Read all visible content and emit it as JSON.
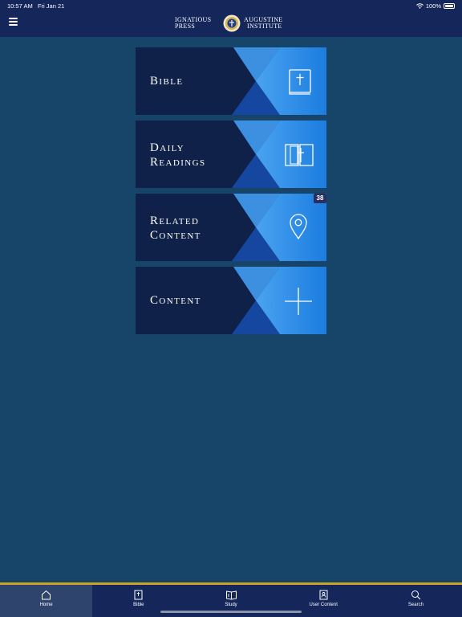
{
  "status": {
    "time": "10:57 AM",
    "date": "Fri Jan 21",
    "battery": "100%"
  },
  "header": {
    "logo_left_line1": "IGNATIOUS",
    "logo_left_line2": "PRESS",
    "logo_right_line1": "AUGUSTINE",
    "logo_right_line2": "INSTITUTE"
  },
  "tiles": [
    {
      "label_line1": "Bible",
      "label_line2": "",
      "icon": "bible-book-icon"
    },
    {
      "label_line1": "Daily",
      "label_line2": "Readings",
      "icon": "daily-readings-icon"
    },
    {
      "label_line1": "Related",
      "label_line2": "Content",
      "icon": "location-pin-icon",
      "badge": "38"
    },
    {
      "label_line1": "Content",
      "label_line2": "",
      "icon": "plus-icon"
    }
  ],
  "tabs": [
    {
      "label": "Home",
      "icon": "home-icon",
      "active": true
    },
    {
      "label": "Bible",
      "icon": "bible-icon",
      "active": false
    },
    {
      "label": "Study",
      "icon": "study-icon",
      "active": false
    },
    {
      "label": "User Content",
      "icon": "user-content-icon",
      "active": false
    },
    {
      "label": "Search",
      "icon": "search-icon",
      "active": false
    }
  ],
  "colors": {
    "background": "#174469",
    "header": "#14265a",
    "tile_dark": "#0f2148",
    "accent_blue": "#1f7fd8",
    "gold": "#c9a227"
  }
}
